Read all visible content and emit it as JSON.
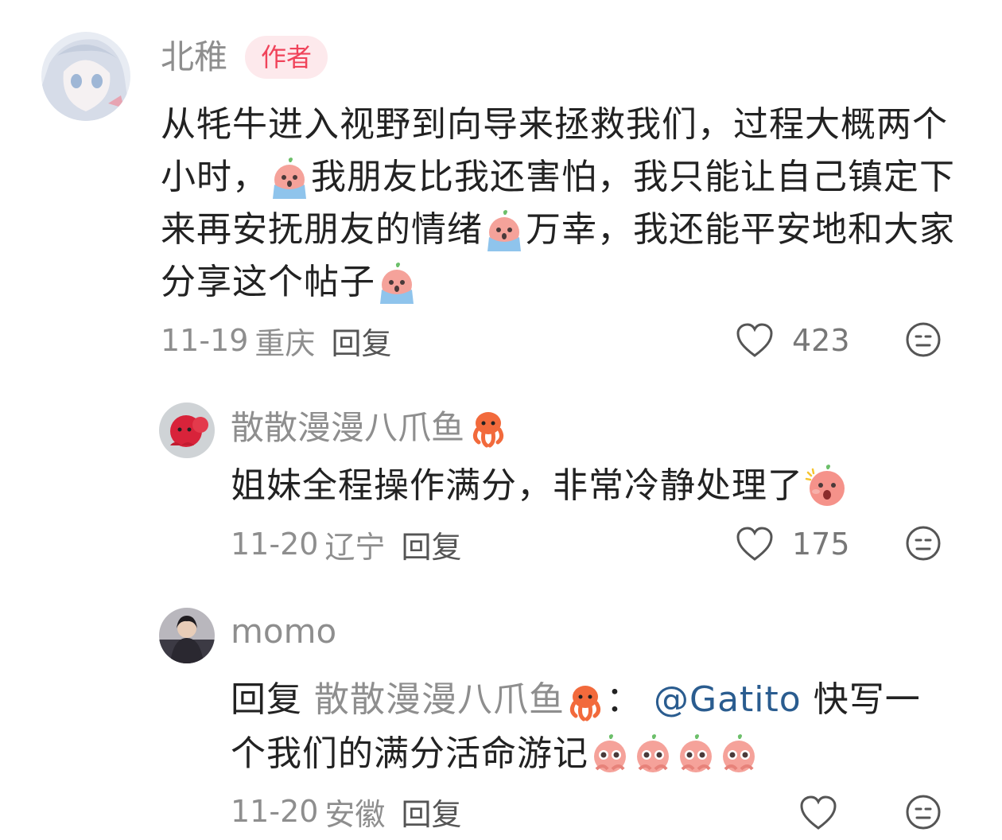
{
  "comments": [
    {
      "username": "北稚",
      "badge": "作者",
      "text_parts": [
        "从牦牛进入视野到向导来拯救我们，过程大概两个小时，",
        "我朋友比我还害怕，我只能让自己镇定下来再安抚朋友的情绪",
        "万幸，我还能平安地和大家分享这个帖子"
      ],
      "emoji": "crying-emoji",
      "date": "11-19",
      "location": "重庆",
      "reply_label": "回复",
      "likes": "423"
    },
    {
      "username": "散散漫漫八爪鱼",
      "username_emoji": "octopus-emoji",
      "text": "姐妹全程操作满分，非常冷静处理了",
      "emoji": "shocked-emoji",
      "date": "11-20",
      "location": "辽宁",
      "reply_label": "回复",
      "likes": "175"
    },
    {
      "username": "momo",
      "reply_prefix": "回复",
      "reply_target": "散散漫漫八爪鱼",
      "reply_colon": "：",
      "mention": "@Gatito",
      "text_line1": "快写一",
      "text_line2": "个我们的满分活命游记",
      "emoji": "pleading-emoji",
      "date": "11-20",
      "location": "安徽",
      "reply_label": "回复",
      "likes": ""
    }
  ],
  "colors": {
    "username": "#8e8e8e",
    "badge_bg": "#fde9ec",
    "badge_text": "#f0435a",
    "mention": "#2a5c8f"
  }
}
